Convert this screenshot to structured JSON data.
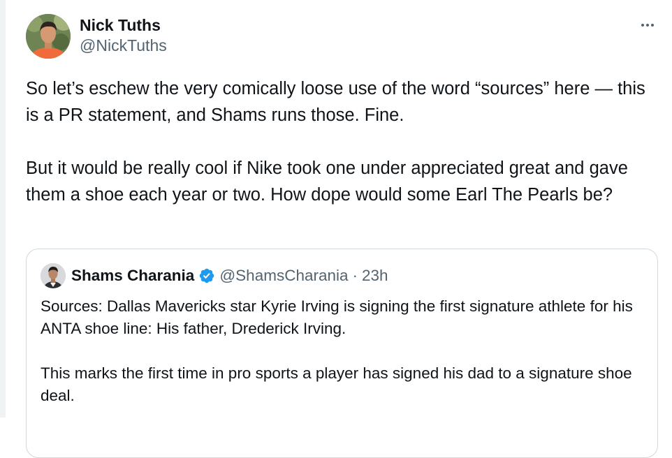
{
  "tweet": {
    "author": {
      "display_name": "Nick Tuths",
      "handle": "@NickTuths",
      "avatar_icon": "person-avatar"
    },
    "more_icon": "more-horizontal-icon",
    "paragraphs": [
      "So let’s eschew the very comically loose use of the word “sources” here — this is a PR statement, and Shams runs those. Fine.",
      "But it would be really cool if Nike took one under appreciated great and gave them a shoe each year or two. How dope would some Earl The Pearls be?"
    ]
  },
  "quoted_tweet": {
    "author": {
      "display_name": "Shams Charania",
      "handle": "@ShamsCharania",
      "separator": "·",
      "time": "23h",
      "verified_icon": "verified-badge-icon",
      "avatar_icon": "person-avatar"
    },
    "paragraphs": [
      "Sources: Dallas Mavericks star Kyrie Irving is signing the first signature athlete for his ANTA shoe line: His father, Drederick Irving.",
      "This marks the first time in pro sports a player has signed his dad to a signature shoe deal."
    ]
  },
  "colors": {
    "text_primary": "#0f1419",
    "text_secondary": "#536471",
    "border": "#cfd9de",
    "verified_blue": "#1d9bf0"
  }
}
